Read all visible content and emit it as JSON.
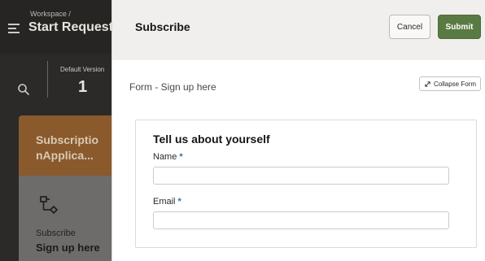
{
  "background": {
    "breadcrumb": "Workspace /",
    "app_title": "Start Request",
    "version_label": "Default Version",
    "version_number": "1",
    "card_title": "Subscriptio nApplica...",
    "card_subtitle": "Subscribe",
    "card_name": "Sign up here"
  },
  "drawer": {
    "title": "Subscribe",
    "cancel_label": "Cancel",
    "submit_label": "Submit",
    "form_heading": "Form - Sign up here",
    "collapse_label": "Collapse Form"
  },
  "form": {
    "section_title": "Tell us about yourself",
    "fields": [
      {
        "label": "Name",
        "required_mark": "*",
        "value": ""
      },
      {
        "label": "Email",
        "required_mark": "*",
        "value": ""
      }
    ]
  },
  "colors": {
    "submit_bg": "#5a7a43",
    "required_mark": "#2f6fb3",
    "card_accent": "#8a5a2c"
  }
}
